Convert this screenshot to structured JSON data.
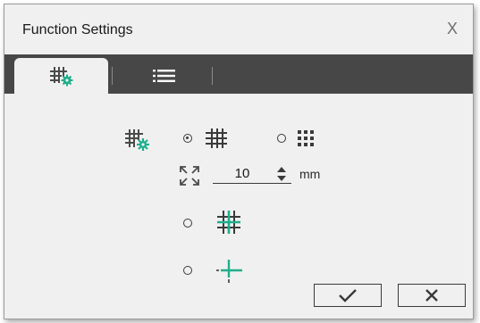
{
  "dialog": {
    "title": "Function Settings",
    "close_label": "X"
  },
  "tabs": [
    {
      "icon": "grid-settings-icon",
      "active": true
    },
    {
      "icon": "list-icon",
      "active": false
    }
  ],
  "grid_settings": {
    "style_options": [
      {
        "icon": "grid-lines-icon",
        "selected": true
      },
      {
        "icon": "grid-dots-icon",
        "selected": false
      }
    ],
    "spacing": {
      "icon": "expand-icon",
      "value": "10",
      "unit": "mm"
    },
    "display_options": [
      {
        "icon": "grid-highlight-icon",
        "selected": false
      },
      {
        "icon": "crosshair-icon",
        "selected": false
      }
    ]
  },
  "actions": {
    "ok_icon": "checkmark-icon",
    "cancel_icon": "x-icon"
  },
  "colors": {
    "accent": "#1fae8c",
    "tabbar": "#474747",
    "panel": "#f0f0f0"
  }
}
